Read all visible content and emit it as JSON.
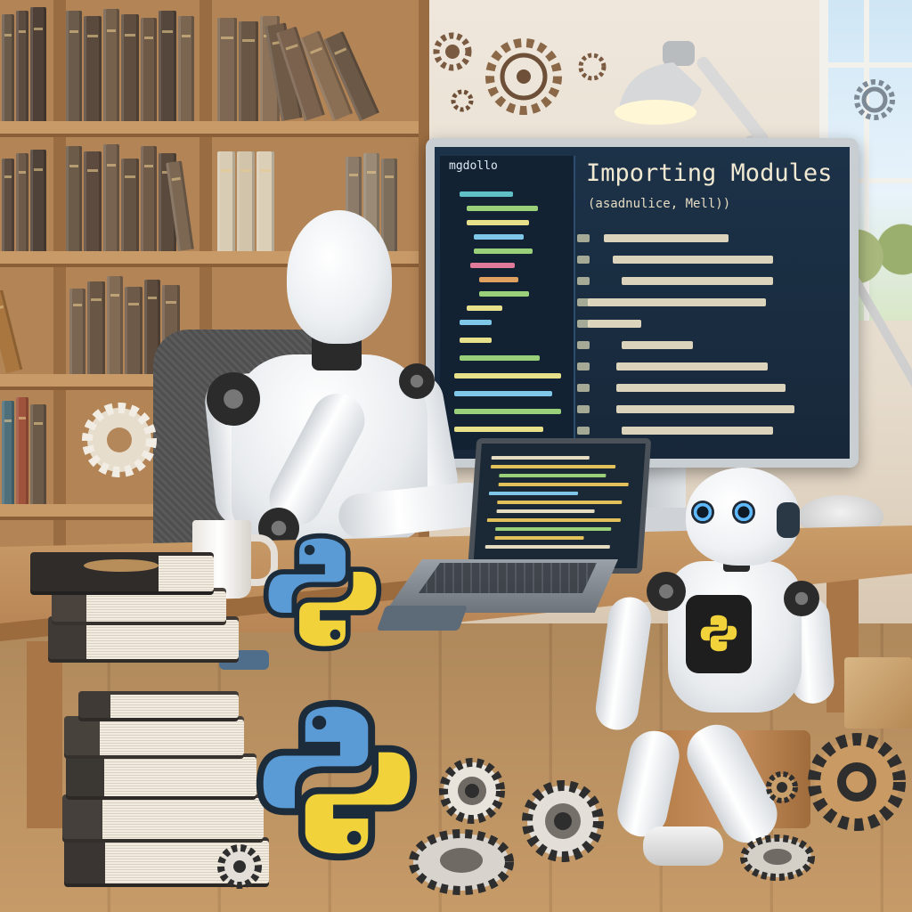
{
  "monitor": {
    "sidebar_title": "mgdollo",
    "title": "Importing Modules",
    "subtitle": "(asadnulice, Mell))"
  },
  "colors": {
    "wall": "#efe7dc",
    "shelf_wood": "#b38455",
    "desk_wood": "#c99c68",
    "screen_bg": "#1c3248",
    "python_blue": "#5b9bd5",
    "python_yellow": "#f2d23a"
  },
  "icons": [
    "python-logo-icon",
    "gear-icon",
    "desk-lamp-icon",
    "coffee-mug-icon"
  ]
}
